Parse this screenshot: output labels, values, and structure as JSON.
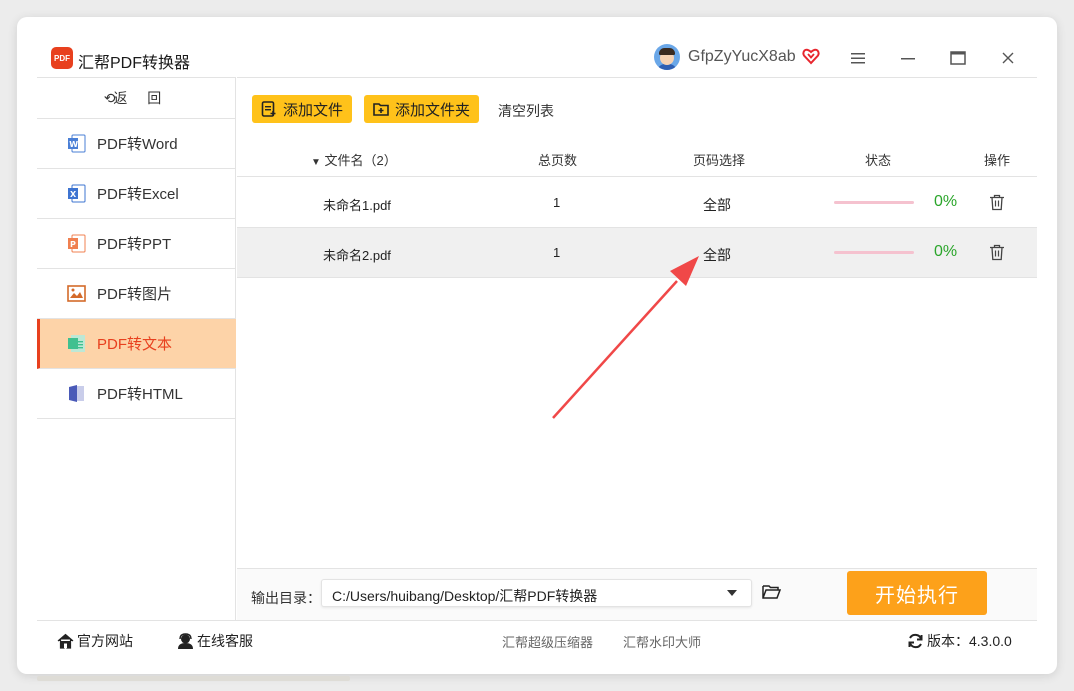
{
  "app": {
    "title": "汇帮PDF转换器",
    "logo_text": "PDF"
  },
  "user": {
    "name": "GfpZyYucX8ab"
  },
  "sidebar": {
    "back_label": "返 回",
    "items": [
      {
        "label": "PDF转Word",
        "icon": "word-icon",
        "color": "#4a7fd6"
      },
      {
        "label": "PDF转Excel",
        "icon": "excel-icon",
        "color": "#3e74d1"
      },
      {
        "label": "PDF转PPT",
        "icon": "ppt-icon",
        "color": "#f08050"
      },
      {
        "label": "PDF转图片",
        "icon": "image-icon",
        "color": "#d46a2a"
      },
      {
        "label": "PDF转文本",
        "icon": "text-icon",
        "color": "#40c090",
        "active": true
      },
      {
        "label": "PDF转HTML",
        "icon": "html-icon",
        "color": "#4a5ab8"
      }
    ]
  },
  "toolbar": {
    "add_file": "添加文件",
    "add_folder": "添加文件夹",
    "clear_list": "清空列表"
  },
  "table": {
    "headers": {
      "filename": "文件名（2）",
      "pages": "总页数",
      "page_select": "页码选择",
      "status": "状态",
      "action": "操作"
    },
    "rows": [
      {
        "filename": "未命名1.pdf",
        "pages": "1",
        "page_select": "全部",
        "progress": 0,
        "progress_label": "0%"
      },
      {
        "filename": "未命名2.pdf",
        "pages": "1",
        "page_select": "全部",
        "progress": 0,
        "progress_label": "0%"
      }
    ]
  },
  "output": {
    "label": "输出目录：",
    "path": "C:/Users/huibang/Desktop/汇帮PDF转换器",
    "start_label": "开始执行"
  },
  "footer": {
    "website": "官方网站",
    "support": "在线客服",
    "link1": "汇帮超级压缩器",
    "link2": "汇帮水印大师",
    "version_label": "版本：",
    "version": "4.3.0.0"
  },
  "colors": {
    "accent": "#e8401e",
    "button_yellow": "#ffc21a",
    "start_orange": "#fda11a",
    "progress_green": "#2aa52a",
    "arrow_red": "#f04848"
  }
}
